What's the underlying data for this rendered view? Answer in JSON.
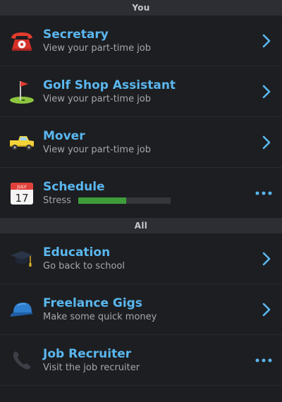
{
  "sections": {
    "you": "You",
    "all": "All"
  },
  "you_items": [
    {
      "icon": "telephone-icon",
      "title": "Secretary",
      "subtitle": "View your part-time job"
    },
    {
      "icon": "golf-flag-icon",
      "title": "Golf Shop Assistant",
      "subtitle": "View your part-time job"
    },
    {
      "icon": "truck-icon",
      "title": "Mover",
      "subtitle": "View your part-time job"
    }
  ],
  "schedule": {
    "icon": "calendar-icon",
    "title": "Schedule",
    "stress_label": "Stress",
    "stress_level": 0.52,
    "stress_color": "#3f9c3b",
    "calendar_month": "JULY",
    "calendar_day": "17"
  },
  "all_items": [
    {
      "icon": "graduation-cap-icon",
      "title": "Education",
      "subtitle": "Go back to school"
    },
    {
      "icon": "cap-icon",
      "title": "Freelance Gigs",
      "subtitle": "Make some quick money"
    },
    {
      "icon": "phone-receiver-icon",
      "title": "Job Recruiter",
      "subtitle": "Visit the job recruiter"
    }
  ],
  "colors": {
    "accent": "#5ab7ef",
    "background": "#1d1e21",
    "header_bg": "#2c2e33"
  }
}
